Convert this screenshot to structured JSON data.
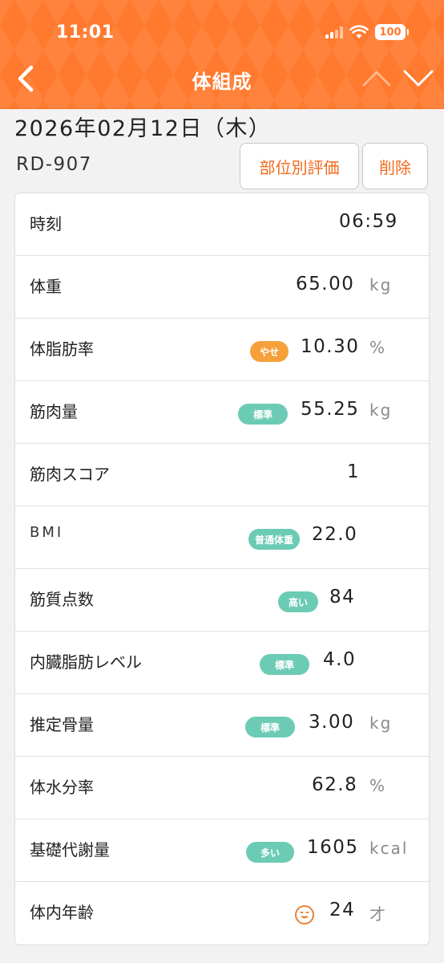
{
  "status_bar": {
    "time": "11:01",
    "battery": "100"
  },
  "nav": {
    "title": "体組成"
  },
  "date": "2026年02月12日（木）",
  "device_model": "RD-907",
  "actions": {
    "region_eval": "部位別評価",
    "delete": "削除"
  },
  "colors": {
    "brand_orange": "#ff7a2e",
    "badge_orange": "#f5a03a",
    "badge_teal": "#6ccbb5",
    "button_text": "#f26a1b"
  },
  "rows": [
    {
      "label": "時刻",
      "value": "06:59",
      "unit": "",
      "badge": ""
    },
    {
      "label": "体重",
      "value": "65.00",
      "unit": "kg",
      "badge": ""
    },
    {
      "label": "体脂肪率",
      "value": "10.30",
      "unit": "%",
      "badge": "やせ",
      "badge_color": "orange"
    },
    {
      "label": "筋肉量",
      "value": "55.25",
      "unit": "kg",
      "badge": "標準",
      "badge_color": "teal"
    },
    {
      "label": "筋肉スコア",
      "value": "1",
      "unit": "",
      "badge": ""
    },
    {
      "label": "BMI",
      "value": "22.0",
      "unit": "",
      "badge": "普通体重",
      "badge_color": "teal"
    },
    {
      "label": "筋質点数",
      "value": "84",
      "unit": "",
      "badge": "高い",
      "badge_color": "teal"
    },
    {
      "label": "内臓脂肪レベル",
      "value": "4.0",
      "unit": "",
      "badge": "標準",
      "badge_color": "teal"
    },
    {
      "label": "推定骨量",
      "value": "3.00",
      "unit": "kg",
      "badge": "標準",
      "badge_color": "teal"
    },
    {
      "label": "体水分率",
      "value": "62.8",
      "unit": "%",
      "badge": ""
    },
    {
      "label": "基礎代謝量",
      "value": "1605",
      "unit": "kcal",
      "badge": "多い",
      "badge_color": "teal"
    },
    {
      "label": "体内年齢",
      "value": "24",
      "unit": "才",
      "badge": "",
      "icon": "smiley-face-icon"
    }
  ]
}
